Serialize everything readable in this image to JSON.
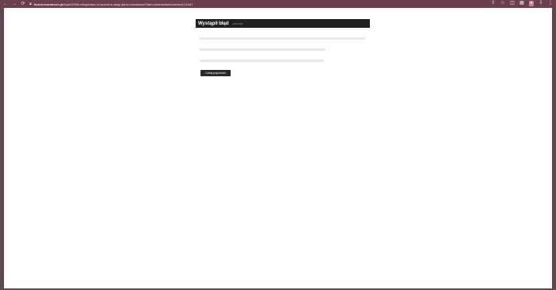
{
  "browser": {
    "back_icon": "←",
    "forward_icon": "→",
    "reload_icon": "⟳",
    "lock_icon": "lock-icon",
    "url_host": "forum.muratorxx.pl",
    "url_path": "/topic/3358-rekuperator-w-kuchni-a-okap-jak-to-rozwiazac/?tab=comments#comment-12447"
  },
  "error": {
    "title": "Wystąpił błąd",
    "code": "[2F173/2]"
  },
  "back_button_label": "Cofnij poprzedni"
}
